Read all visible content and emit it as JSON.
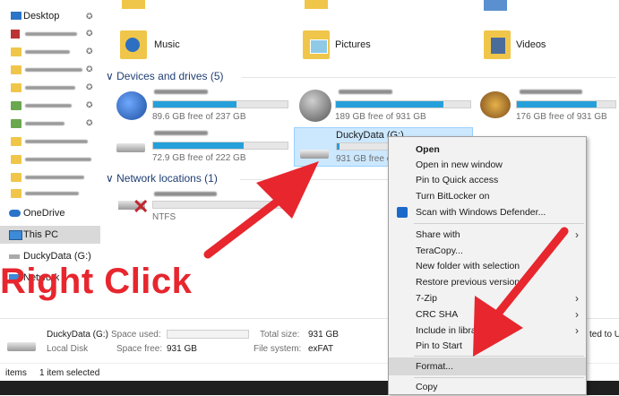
{
  "sidebar": {
    "desktop": "Desktop",
    "onedrive": "OneDrive",
    "thispc": "This PC",
    "duckydata": "DuckyData (G:)",
    "network": "Network"
  },
  "folders": {
    "music": "Music",
    "pictures": "Pictures",
    "videos": "Videos"
  },
  "devices": {
    "header": "Devices and drives (5)",
    "drives": [
      {
        "free": "89.6 GB free of 237 GB",
        "fill": 0.62
      },
      {
        "free": "189 GB free of 931 GB",
        "fill": 0.8
      },
      {
        "free": "176 GB free of 931 GB",
        "fill": 0.81
      },
      {
        "free": "72.9 GB free of 222 GB",
        "fill": 0.67
      },
      {
        "name": "DuckyData (G:)",
        "free": "931 GB free of",
        "fill": 0.02
      }
    ]
  },
  "network_locations": {
    "header": "Network locations (1)",
    "fs": "NTFS"
  },
  "details": {
    "name": "DuckyData (G:)",
    "type": "Local Disk",
    "space_used_label": "Space used:",
    "space_free_label": "Space free:",
    "space_free_value": "931 GB",
    "total_size_label": "Total size:",
    "total_size_value": "931 GB",
    "fs_label": "File system:",
    "fs_value": "exFAT",
    "cut_text": "ted to U"
  },
  "status": {
    "items": "items",
    "selected": "1 item selected"
  },
  "context_menu": {
    "open": "Open",
    "open_new_window": "Open in new window",
    "pin_quick": "Pin to Quick access",
    "bitlocker": "Turn BitLocker on",
    "defender": "Scan with Windows Defender...",
    "share_with": "Share with",
    "teracopy": "TeraCopy...",
    "new_folder_sel": "New folder with selection",
    "restore": "Restore previous versions",
    "sevenzip": "7-Zip",
    "crc": "CRC SHA",
    "include_lib": "Include in library",
    "pin_start": "Pin to Start",
    "format": "Format...",
    "copy": "Copy"
  },
  "annotation": {
    "text": "Right Click",
    "color": "#e7262e"
  },
  "colors": {
    "accent": "#26a0da",
    "selection": "#cce8ff",
    "arrow": "#e7262e"
  }
}
